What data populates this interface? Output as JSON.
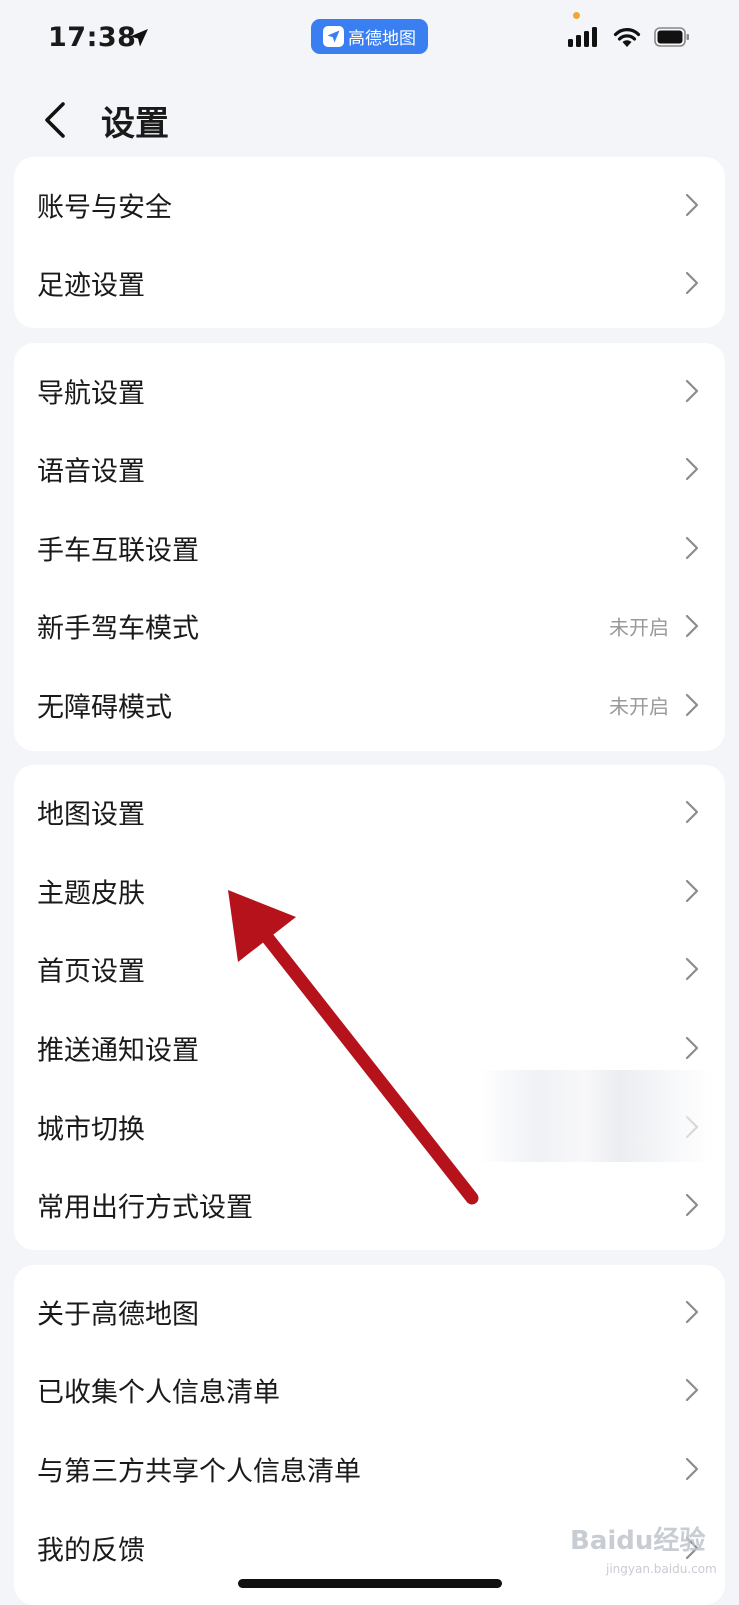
{
  "status_bar": {
    "time": "17:38",
    "app_pill_label": "高德地图",
    "icons": [
      "location-arrow-icon",
      "cellular-signal-icon",
      "wifi-icon",
      "battery-icon"
    ]
  },
  "header": {
    "title": "设置",
    "back_icon": "chevron-left-icon"
  },
  "groups": [
    {
      "items": [
        {
          "label": "账号与安全",
          "value": ""
        },
        {
          "label": "足迹设置",
          "value": ""
        }
      ]
    },
    {
      "items": [
        {
          "label": "导航设置",
          "value": ""
        },
        {
          "label": "语音设置",
          "value": ""
        },
        {
          "label": "手车互联设置",
          "value": ""
        },
        {
          "label": "新手驾车模式",
          "value": "未开启"
        },
        {
          "label": "无障碍模式",
          "value": "未开启"
        }
      ]
    },
    {
      "items": [
        {
          "label": "地图设置",
          "value": ""
        },
        {
          "label": "主题皮肤",
          "value": ""
        },
        {
          "label": "首页设置",
          "value": ""
        },
        {
          "label": "推送通知设置",
          "value": ""
        },
        {
          "label": "城市切换",
          "value": ""
        },
        {
          "label": "常用出行方式设置",
          "value": ""
        }
      ]
    },
    {
      "items": [
        {
          "label": "关于高德地图",
          "value": ""
        },
        {
          "label": "已收集个人信息清单",
          "value": ""
        },
        {
          "label": "与第三方共享个人信息清单",
          "value": ""
        },
        {
          "label": "我的反馈",
          "value": ""
        }
      ]
    }
  ],
  "watermark": {
    "text": "Baidu经验",
    "sub": "jingyan.baidu.com"
  },
  "colors": {
    "background": "#f4f5f9",
    "card": "#ffffff",
    "app_pill": "#3a7ff2",
    "annotation_arrow": "#b5121b",
    "secondary_text": "#9a9a9a"
  }
}
